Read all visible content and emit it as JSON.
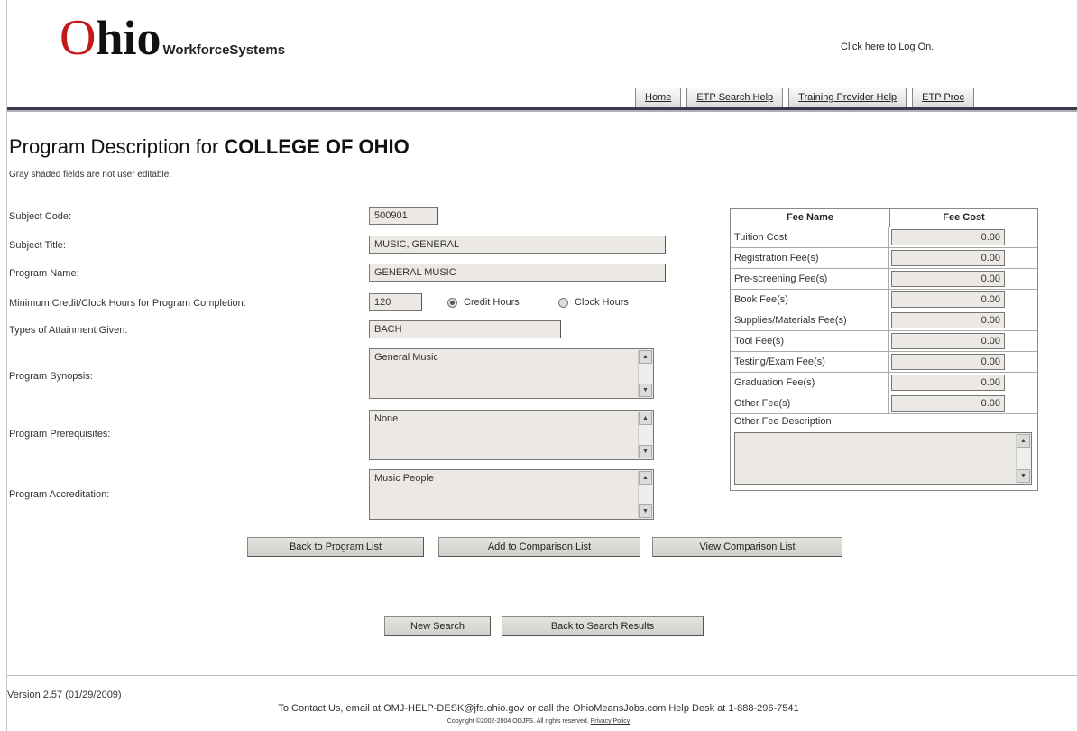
{
  "header": {
    "logo_o": "O",
    "logo_hio": "hio",
    "logo_sub": "WorkforceSystems",
    "logon_link": "Click here to Log On.",
    "tabs": [
      "Home",
      "ETP Search Help",
      "Training Provider Help",
      "ETP Proc"
    ]
  },
  "page": {
    "title_prefix": "Program Description for ",
    "title_org": "COLLEGE OF OHIO",
    "note": "Gray shaded fields are not user editable."
  },
  "form": {
    "subject_code_label": "Subject Code:",
    "subject_code": "500901",
    "subject_title_label": "Subject Title:",
    "subject_title": "MUSIC, GENERAL",
    "program_name_label": "Program Name:",
    "program_name": "GENERAL MUSIC",
    "min_hours_label": "Minimum Credit/Clock Hours for Program Completion:",
    "min_hours": "120",
    "credit_hours_label": "Credit Hours",
    "clock_hours_label": "Clock Hours",
    "selected_hours_type": "Credit Hours",
    "attainment_label": "Types of Attainment Given:",
    "attainment": "BACH",
    "synopsis_label": "Program Synopsis:",
    "synopsis": "General Music",
    "prerequisites_label": "Program Prerequisites:",
    "prerequisites": "None",
    "accreditation_label": "Program Accreditation:",
    "accreditation": "Music People"
  },
  "fees": {
    "header_name": "Fee Name",
    "header_cost": "Fee Cost",
    "rows": [
      {
        "name": "Tuition Cost",
        "cost": "0.00"
      },
      {
        "name": "Registration Fee(s)",
        "cost": "0.00"
      },
      {
        "name": "Pre-screening Fee(s)",
        "cost": "0.00"
      },
      {
        "name": "Book Fee(s)",
        "cost": "0.00"
      },
      {
        "name": "Supplies/Materials Fee(s)",
        "cost": "0.00"
      },
      {
        "name": "Tool Fee(s)",
        "cost": "0.00"
      },
      {
        "name": "Testing/Exam Fee(s)",
        "cost": "0.00"
      },
      {
        "name": "Graduation Fee(s)",
        "cost": "0.00"
      },
      {
        "name": "Other Fee(s)",
        "cost": "0.00"
      }
    ],
    "other_desc_label": "Other Fee Description",
    "other_desc": ""
  },
  "buttons": {
    "back_to_program_list": "Back to Program List",
    "add_to_comparison": "Add to Comparison List",
    "view_comparison": "View Comparison List",
    "new_search": "New Search",
    "back_to_results": "Back to Search Results"
  },
  "footer": {
    "version": "Version 2.57 (01/29/2009)",
    "contact": "To Contact Us, email at OMJ-HELP-DESK@jfs.ohio.gov or call the OhioMeansJobs.com Help Desk at 1-888-296-7541",
    "copyright": "Copyright ©2002-2004 ODJFS. All rights reserved.",
    "privacy": "Privacy Policy"
  },
  "colors": {
    "logo_red": "#c51818",
    "readonly_field": "#ece9e4",
    "header_bar": "#3a3a4a"
  }
}
